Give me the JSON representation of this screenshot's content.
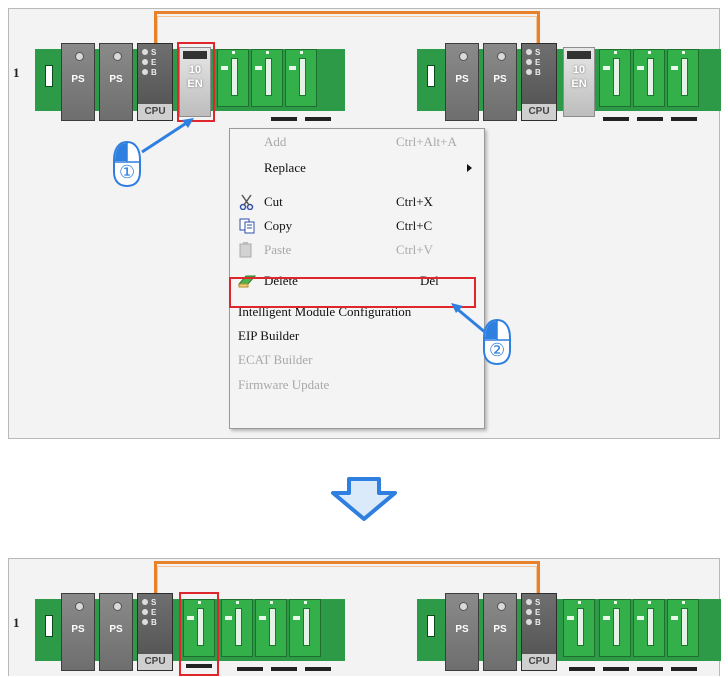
{
  "row_label": "1",
  "modules": {
    "ps_label": "PS",
    "cpu_label": "CPU",
    "cpu_indicators": [
      "S",
      "E",
      "B"
    ],
    "en_top": "10",
    "en_bottom": "EN"
  },
  "context_menu": {
    "items": [
      {
        "label": "Add",
        "shortcut": "Ctrl+Alt+A",
        "enabled": false
      },
      {
        "label": "Replace",
        "shortcut": "",
        "enabled": true,
        "submenu": true
      },
      {
        "label": "Cut",
        "shortcut": "Ctrl+X",
        "enabled": true,
        "icon": "scissors-icon"
      },
      {
        "label": "Copy",
        "shortcut": "Ctrl+C",
        "enabled": true,
        "icon": "copy-icon"
      },
      {
        "label": "Paste",
        "shortcut": "Ctrl+V",
        "enabled": false,
        "icon": "paste-icon"
      },
      {
        "label": "Delete",
        "shortcut": "Del",
        "enabled": true,
        "icon": "eraser-icon"
      },
      {
        "label": "Intelligent Module Configuration",
        "shortcut": "",
        "enabled": true
      },
      {
        "label": "EIP Builder",
        "shortcut": "",
        "enabled": true
      },
      {
        "label": "ECAT Builder",
        "shortcut": "",
        "enabled": false
      },
      {
        "label": "Firmware Update",
        "shortcut": "",
        "enabled": false
      }
    ]
  },
  "steps": [
    "①",
    "②"
  ],
  "colors": {
    "highlight": "#e0262d",
    "cable": "#e8822a",
    "arrow": "#2f7fe0",
    "module_green": "#33b04a"
  }
}
